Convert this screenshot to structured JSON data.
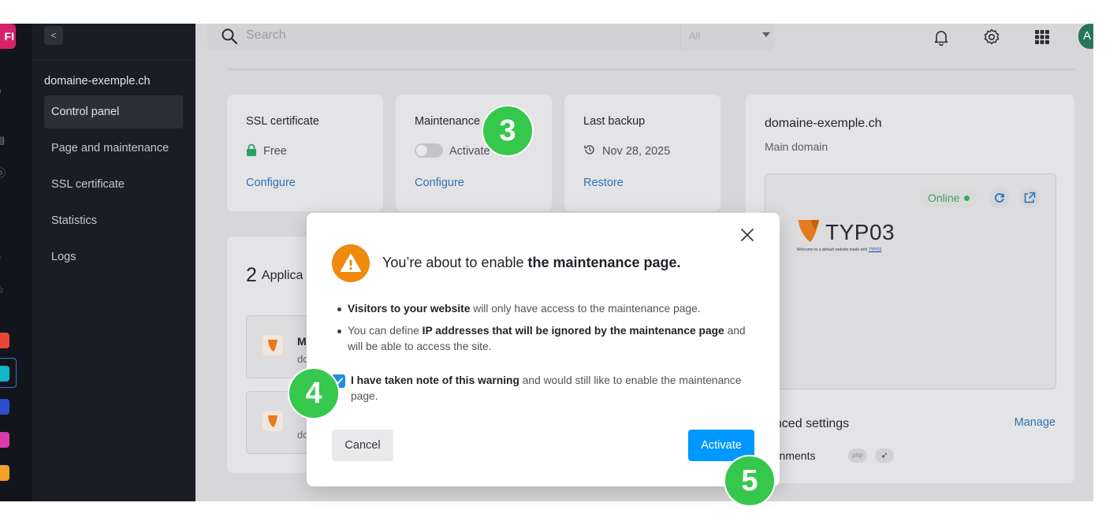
{
  "app": {
    "logo_text": "FI"
  },
  "topbar": {
    "search_placeholder": "Search",
    "filter_value": "All",
    "icons": [
      "bell-icon",
      "gear-icon",
      "apps-grid-icon"
    ],
    "avatar_initial": "A"
  },
  "sidebar": {
    "back_icon": "chevron-left-icon",
    "domain": "domaine-exemple.ch",
    "items": [
      {
        "label": "Control panel",
        "active": true
      },
      {
        "label": "Page and maintenance",
        "active": false
      },
      {
        "label": "SSL certificate",
        "active": false
      },
      {
        "label": "Statistics",
        "active": false
      },
      {
        "label": "Logs",
        "active": false
      }
    ]
  },
  "cards": {
    "ssl": {
      "title": "SSL certificate",
      "value": "Free",
      "link": "Configure"
    },
    "maintenance": {
      "title": "Maintenance",
      "toggle_label": "Activate",
      "toggle_on": false,
      "link": "Configure"
    },
    "backup": {
      "title": "Last backup",
      "value": "Nov 28, 2025",
      "link": "Restore"
    }
  },
  "domain_card": {
    "title": "domaine-exemple.ch",
    "subtitle": "Main domain",
    "status": "Online",
    "status_color": "#3ea764",
    "preview": {
      "logo_word": "TYP03",
      "welcome_text": "Welcome to a default website made with",
      "welcome_link": "TYPO3"
    },
    "advanced_title": "vanced settings",
    "manage_link": "Manage",
    "env_label": "vironments",
    "env_php": "php"
  },
  "applications": {
    "count": "2",
    "title": "Applica",
    "rows": [
      {
        "name": "M",
        "sub": "do"
      },
      {
        "name": "",
        "sub": "do"
      }
    ]
  },
  "modal": {
    "title_prefix": "You’re about to enable ",
    "title_bold": "the maintenance page.",
    "bullet1_bold": "Visitors to your website",
    "bullet1_rest": " will only have access to the maintenance page.",
    "bullet2_pre": "You can define ",
    "bullet2_bold": "IP addresses that will be ignored by the maintenance page",
    "bullet2_rest": " and will be able to access the site.",
    "checkbox_checked": true,
    "checkbox_bold": "I have taken note of this warning",
    "checkbox_rest": " and would still like to enable the maintenance page.",
    "cancel_label": "Cancel",
    "activate_label": "Activate",
    "accent_color": "#0098ff",
    "warning_color": "#ef8a0c"
  },
  "steps": [
    "3",
    "4",
    "5"
  ]
}
